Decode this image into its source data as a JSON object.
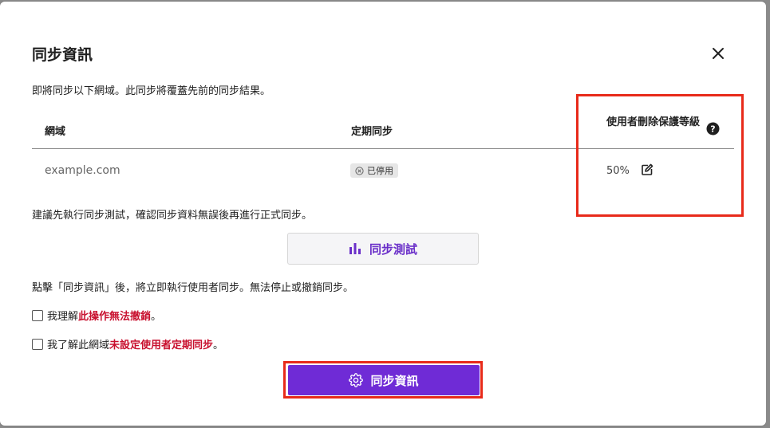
{
  "dialog": {
    "title": "同步資訊",
    "description": "即將同步以下網域。此同步將覆蓋先前的同步結果。",
    "close_icon": "close-icon"
  },
  "table": {
    "columns": {
      "domain": "網域",
      "schedule": "定期同步",
      "protection": "使用者刪除保護等級"
    },
    "rows": [
      {
        "domain": "example.com",
        "schedule_status": "已停用",
        "protection_level": "50%"
      }
    ]
  },
  "suggestion": "建議先執行同步測試，確認同步資料無誤後再進行正式同步。",
  "test_button": {
    "label": "同步測試",
    "icon": "bar-chart-icon"
  },
  "notice": "點擊「同步資訊」後，將立即執行使用者同步。無法停止或撤銷同步。",
  "confirmations": [
    {
      "prefix": "我理解",
      "emphasis": "此操作無法撤銷",
      "suffix": "。",
      "checked": false
    },
    {
      "prefix": "我了解此網域",
      "emphasis": "未設定使用者定期同步",
      "suffix": "。",
      "checked": false
    }
  ],
  "sync_button": {
    "label": "同步資訊",
    "icon": "gear-icon"
  },
  "colors": {
    "primary": "#6f2bd6",
    "warning_text": "#c8102e",
    "highlight": "#e82a1a"
  }
}
